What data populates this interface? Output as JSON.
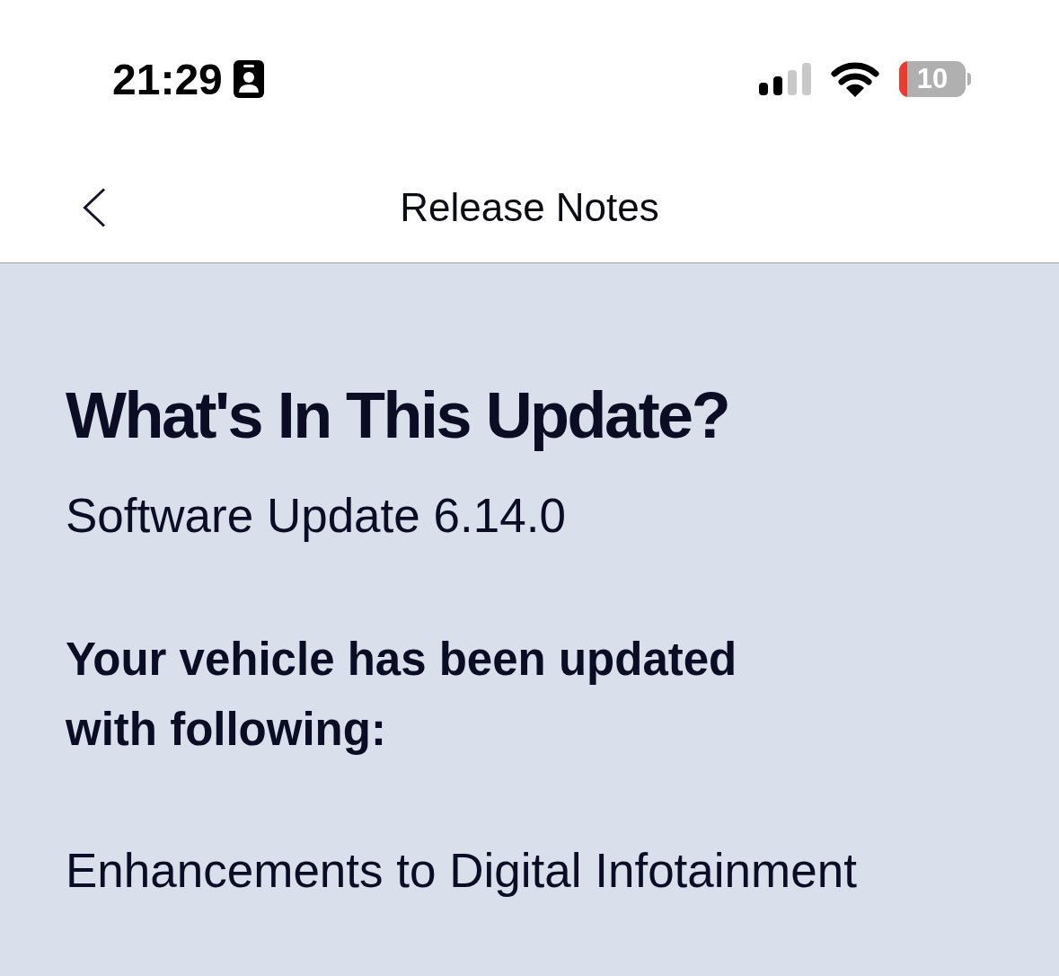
{
  "status_bar": {
    "time": "21:29",
    "battery": "10"
  },
  "nav_bar": {
    "title": "Release Notes"
  },
  "content": {
    "heading": "What's In This Update?",
    "subtitle": "Software Update 6.14.0",
    "intro": "Your vehicle has been updated with following:",
    "items": [
      "Enhancements to Digital Infotainment"
    ]
  }
}
